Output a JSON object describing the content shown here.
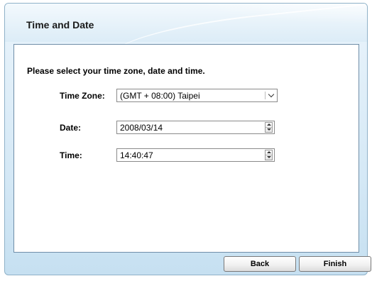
{
  "header": {
    "title": "Time and Date"
  },
  "form": {
    "instruction": "Please select your time zone, date and time.",
    "timezone": {
      "label": "Time Zone:",
      "value": "(GMT + 08:00) Taipei"
    },
    "date": {
      "label": "Date:",
      "value": "2008/03/14"
    },
    "time": {
      "label": "Time:",
      "value": "14:40:47"
    }
  },
  "buttons": {
    "back": "Back",
    "finish": "Finish"
  },
  "colors": {
    "frame_border": "#8fb1c8",
    "content_border": "#6f8ea8",
    "header_bg": "#dcecf7"
  }
}
